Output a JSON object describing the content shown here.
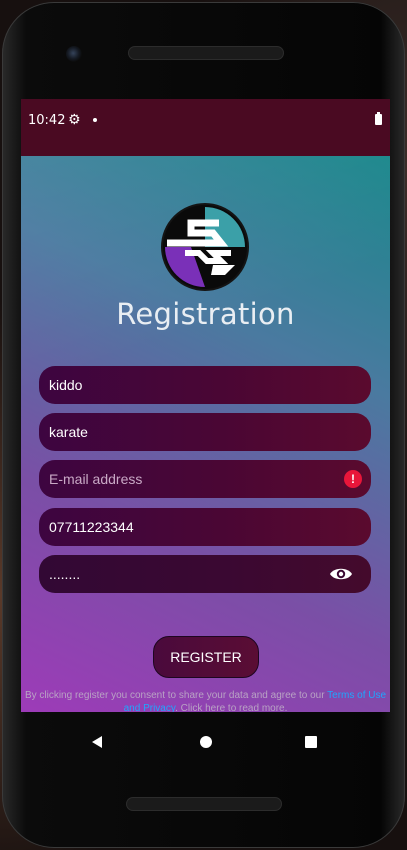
{
  "status": {
    "time": "10:42",
    "icons": [
      "gear-icon",
      "notification-dot",
      "battery-icon"
    ]
  },
  "logo": {
    "icon": "registration-logo"
  },
  "title": "Registration",
  "fields": [
    {
      "name": "username",
      "value": "kiddo",
      "placeholder": ""
    },
    {
      "name": "name",
      "value": "karate",
      "placeholder": ""
    },
    {
      "name": "email",
      "value": "",
      "placeholder": "E-mail address",
      "error": true
    },
    {
      "name": "phone",
      "value": "07711223344",
      "placeholder": ""
    },
    {
      "name": "password",
      "value": "........",
      "placeholder": "",
      "toggle_icon": "eye-icon"
    }
  ],
  "register_label": "REGISTER",
  "consent": {
    "text_before": "By clicking register you consent to share your data and agree to our ",
    "link_text": "Terms of Use and Privacy",
    "text_after": ". Click here to read more."
  },
  "colors": {
    "status_bar": "#4a0a22",
    "field": "#4a0634",
    "error": "#e8163a",
    "link": "#1ea7ff"
  }
}
